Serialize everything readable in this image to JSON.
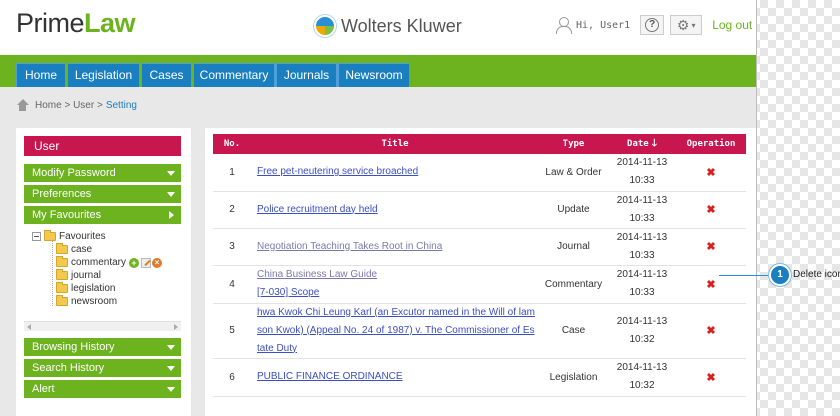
{
  "header": {
    "logo_part1": "Prime",
    "logo_part2": "Law",
    "brand": "Wolters Kluwer",
    "greeting": "Hi, User1",
    "help_glyph": "?",
    "gear_glyph": "⚙",
    "logout": "Log out"
  },
  "nav": {
    "tabs": [
      {
        "label": "Home"
      },
      {
        "label": "Legislation"
      },
      {
        "label": "Cases"
      },
      {
        "label": "Commentary"
      },
      {
        "label": "Journals"
      },
      {
        "label": "Newsroom"
      }
    ]
  },
  "breadcrumb": {
    "trail": "Home > User >",
    "current": "Setting"
  },
  "sidebar": {
    "title": "User",
    "modify_password": "Modify Password",
    "preferences": "Preferences",
    "my_favourites": "My Favourites",
    "tree": {
      "root": "Favourites",
      "folders": [
        "case",
        "commentary",
        "journal",
        "legislation",
        "newsroom"
      ]
    },
    "browsing_history": "Browsing History",
    "search_history": "Search History",
    "alert": "Alert"
  },
  "table": {
    "headers": {
      "no": "No.",
      "title": "Title",
      "type": "Type",
      "date": "Date",
      "operation": "Operation"
    },
    "rows": [
      {
        "no": "1",
        "title": "Free pet-neutering service broached",
        "type": "Law & Order",
        "date": "2014-11-13",
        "time": "10:33"
      },
      {
        "no": "2",
        "title": "Police recruitment day held",
        "type": "Update",
        "date": "2014-11-13",
        "time": "10:33"
      },
      {
        "no": "3",
        "title": "Negotiation Teaching Takes Root in China",
        "type": "Journal",
        "date": "2014-11-13",
        "time": "10:33"
      },
      {
        "no": "4",
        "title": "China Business Law Guide",
        "subtitle": "[7-030] Scope",
        "type": "Commentary",
        "date": "2014-11-13",
        "time": "10:33"
      },
      {
        "no": "5",
        "title_line1": "hwa Kwok Chi Leung Karl (an Excutor named in the Will of lam",
        "title_line2": "son Kwok) (Appeal No. 24 of 1987) v. The Commissioner of Es",
        "title_line3": "tate Duty",
        "type": "Case",
        "date": "2014-11-13",
        "time": "10:32"
      },
      {
        "no": "6",
        "title": "PUBLIC FINANCE ORDINANCE",
        "type": "Legislation",
        "date": "2014-11-13",
        "time": "10:32"
      }
    ],
    "delete_glyph": "✖"
  },
  "callout": {
    "number": "1",
    "text": "Delete icon"
  }
}
